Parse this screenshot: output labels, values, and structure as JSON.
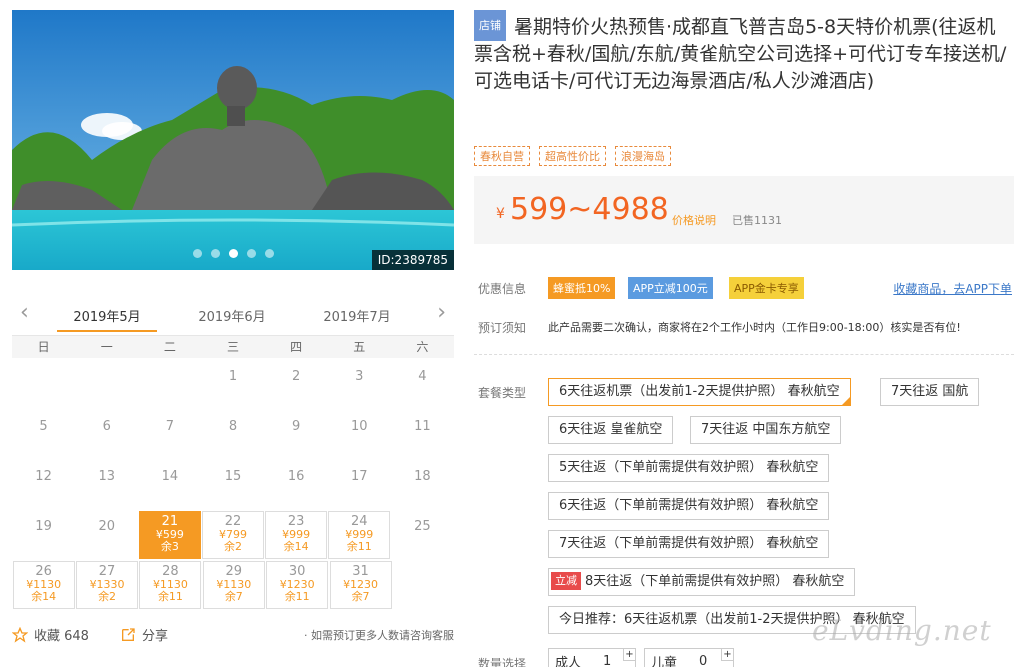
{
  "gallery": {
    "id_label": "ID:2389785",
    "dots": 5,
    "active_dot": 2
  },
  "calendar": {
    "months": [
      "2019年5月",
      "2019年6月",
      "2019年7月"
    ],
    "active_month": 0,
    "weekdays": [
      "日",
      "一",
      "二",
      "三",
      "四",
      "五",
      "六"
    ],
    "rows": [
      [
        {
          "d": ""
        },
        {
          "d": ""
        },
        {
          "d": ""
        },
        {
          "d": "1"
        },
        {
          "d": "2"
        },
        {
          "d": "3"
        },
        {
          "d": "4"
        }
      ],
      [
        {
          "d": "5"
        },
        {
          "d": "6"
        },
        {
          "d": "7"
        },
        {
          "d": "8"
        },
        {
          "d": "9"
        },
        {
          "d": "10"
        },
        {
          "d": "11"
        }
      ],
      [
        {
          "d": "12"
        },
        {
          "d": "13"
        },
        {
          "d": "14"
        },
        {
          "d": "15"
        },
        {
          "d": "16"
        },
        {
          "d": "17"
        },
        {
          "d": "18"
        }
      ],
      [
        {
          "d": "19"
        },
        {
          "d": "20"
        },
        {
          "d": "21",
          "p": "¥599",
          "r": "余3",
          "sel": true
        },
        {
          "d": "22",
          "p": "¥799",
          "r": "余2"
        },
        {
          "d": "23",
          "p": "¥999",
          "r": "余14"
        },
        {
          "d": "24",
          "p": "¥999",
          "r": "余11"
        },
        {
          "d": "25"
        }
      ],
      [
        {
          "d": "26",
          "p": "¥1130",
          "r": "余14"
        },
        {
          "d": "27",
          "p": "¥1330",
          "r": "余2"
        },
        {
          "d": "28",
          "p": "¥1130",
          "r": "余11"
        },
        {
          "d": "29",
          "p": "¥1130",
          "r": "余7"
        },
        {
          "d": "30",
          "p": "¥1230",
          "r": "余11"
        },
        {
          "d": "31",
          "p": "¥1230",
          "r": "余7"
        }
      ]
    ]
  },
  "footer": {
    "fav_label": "收藏 648",
    "share_label": "分享",
    "note": "· 如需预订更多人数请咨询客服"
  },
  "product": {
    "badge": "店铺",
    "title": "暑期特价火热预售·成都直飞普吉岛5-8天特价机票(往返机票含税+春秋/国航/东航/黄雀航空公司选择+可代订专车接送机/可选电话卡/可代订无边海景酒店/私人沙滩酒店)",
    "tags": [
      "春秋自营",
      "超高性价比",
      "浪漫海岛"
    ],
    "currency": "¥",
    "price": "599~4988",
    "price_note": "价格说明",
    "sold": "已售1131"
  },
  "promo": {
    "label": "优惠信息",
    "items": [
      {
        "text": "蜂蜜抵10%",
        "color": "#f59a23",
        "text_color": "#ffffff"
      },
      {
        "text": "APP立减100元",
        "color": "#5b9be0",
        "text_color": "#ffffff"
      },
      {
        "text": "APP金卡专享",
        "color": "#f5d03a",
        "text_color": "#8a5a00"
      }
    ],
    "fav_link": "收藏商品，去APP下单"
  },
  "booking": {
    "label": "预订须知",
    "note": "此产品需要二次确认，商家将在2个工作小时内（工作日9:00-18:00）核实是否有位!"
  },
  "packages": {
    "label": "套餐类型",
    "items": [
      {
        "text": "6天往返机票（出发前1-2天提供护照） 春秋航空",
        "selected": true
      },
      {
        "text": "7天往返 国航"
      },
      {
        "text": "6天往返 皇雀航空"
      },
      {
        "text": "7天往返 中国东方航空"
      },
      {
        "text": "5天往返（下单前需提供有效护照） 春秋航空"
      },
      {
        "text": "6天往返（下单前需提供有效护照） 春秋航空"
      },
      {
        "text": "7天往返（下单前需提供有效护照） 春秋航空"
      },
      {
        "text": "8天往返（下单前需提供有效护照） 春秋航空",
        "ribbon": "立减"
      },
      {
        "text": "今日推荐：6天往返机票（出发前1-2天提供护照） 春秋航空"
      }
    ]
  },
  "quantity": {
    "label": "数量选择",
    "adult_label": "成人",
    "adult": "1",
    "child_label": "儿童",
    "child": "0",
    "plus": "+"
  },
  "watermark": "eLvding.net"
}
